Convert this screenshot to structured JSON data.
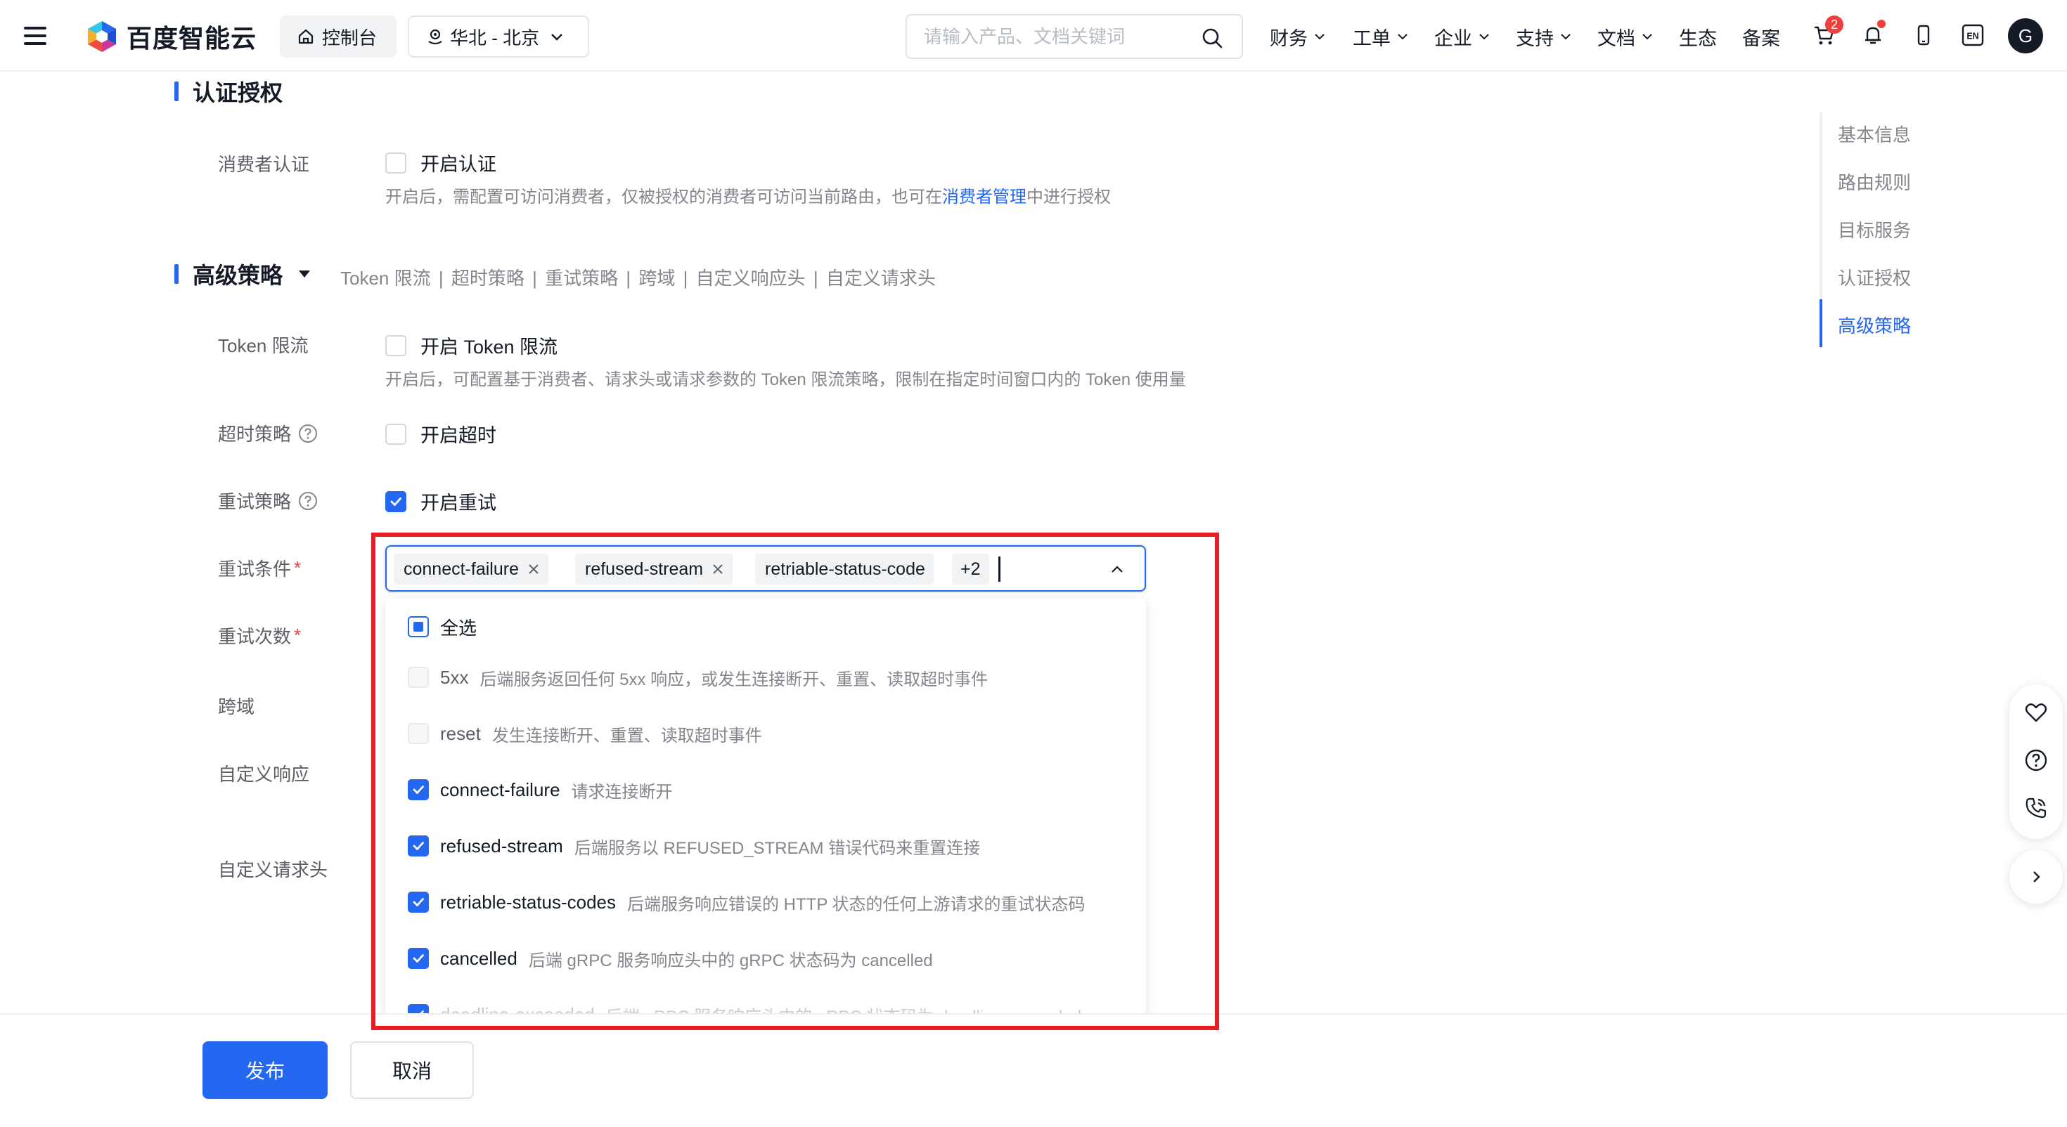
{
  "header": {
    "brand": "百度智能云",
    "console_label": "控制台",
    "region_label": "华北 - 北京",
    "search_placeholder": "请输入产品、文档关键词",
    "nav": [
      "财务",
      "工单",
      "企业",
      "支持",
      "文档",
      "生态",
      "备案"
    ],
    "cart_badge": "2",
    "lang_label": "EN",
    "avatar_letter": "G"
  },
  "auth": {
    "title": "认证授权",
    "consumer_label": "消费者认证",
    "consumer_checkbox": "开启认证",
    "consumer_hint_pre": "开启后，需配置可访问消费者，仅被授权的消费者可访问当前路由，也可在",
    "consumer_hint_link": "消费者管理",
    "consumer_hint_post": "中进行授权"
  },
  "advanced": {
    "title": "高级策略",
    "summary": [
      "Token 限流",
      "|",
      "超时策略",
      "|",
      "重试策略",
      "|",
      "跨域",
      "|",
      "自定义响应头",
      "|",
      "自定义请求头"
    ],
    "token_label": "Token 限流",
    "token_checkbox": "开启 Token 限流",
    "token_hint": "开启后，可配置基于消费者、请求头或请求参数的 Token 限流策略，限制在指定时间窗口内的 Token 使用量",
    "timeout_label": "超时策略",
    "timeout_checkbox": "开启超时",
    "retry_label": "重试策略",
    "retry_checkbox": "开启重试",
    "retry_cond_label": "重试条件",
    "retry_count_label": "重试次数",
    "cors_label": "跨域",
    "custom_resp_label": "自定义响应",
    "custom_req_label": "自定义请求头",
    "required_mark": "*"
  },
  "retry_select": {
    "tags": [
      "connect-failure",
      "refused-stream",
      "retriable-status-code"
    ],
    "more": "+2",
    "select_all": "全选",
    "options": [
      {
        "name": "5xx",
        "desc": "后端服务返回任何 5xx 响应，或发生连接断开、重置、读取超时事件",
        "checked": false,
        "disabled": true
      },
      {
        "name": "reset",
        "desc": "发生连接断开、重置、读取超时事件",
        "checked": false,
        "disabled": true
      },
      {
        "name": "connect-failure",
        "desc": "请求连接断开",
        "checked": true,
        "disabled": false
      },
      {
        "name": "refused-stream",
        "desc": "后端服务以 REFUSED_STREAM 错误代码来重置连接",
        "checked": true,
        "disabled": false
      },
      {
        "name": "retriable-status-codes",
        "desc": "后端服务响应错误的 HTTP 状态的任何上游请求的重试状态码",
        "checked": true,
        "disabled": false
      },
      {
        "name": "cancelled",
        "desc": "后端 gRPC 服务响应头中的 gRPC 状态码为 cancelled",
        "checked": true,
        "disabled": false
      },
      {
        "name": "deadline-exceeded",
        "desc": "后端 gRPC 服务响应头中的 gRPC 状态码为 deadline-exceeded",
        "checked": true,
        "disabled": false
      }
    ]
  },
  "anchors": {
    "items": [
      "基本信息",
      "路由规则",
      "目标服务",
      "认证授权",
      "高级策略"
    ],
    "active": "高级策略"
  },
  "footer": {
    "publish": "发布",
    "cancel": "取消"
  },
  "colors": {
    "accent": "#2468f2",
    "highlight_frame": "#ea1c24",
    "badge": "#f33e3e"
  }
}
